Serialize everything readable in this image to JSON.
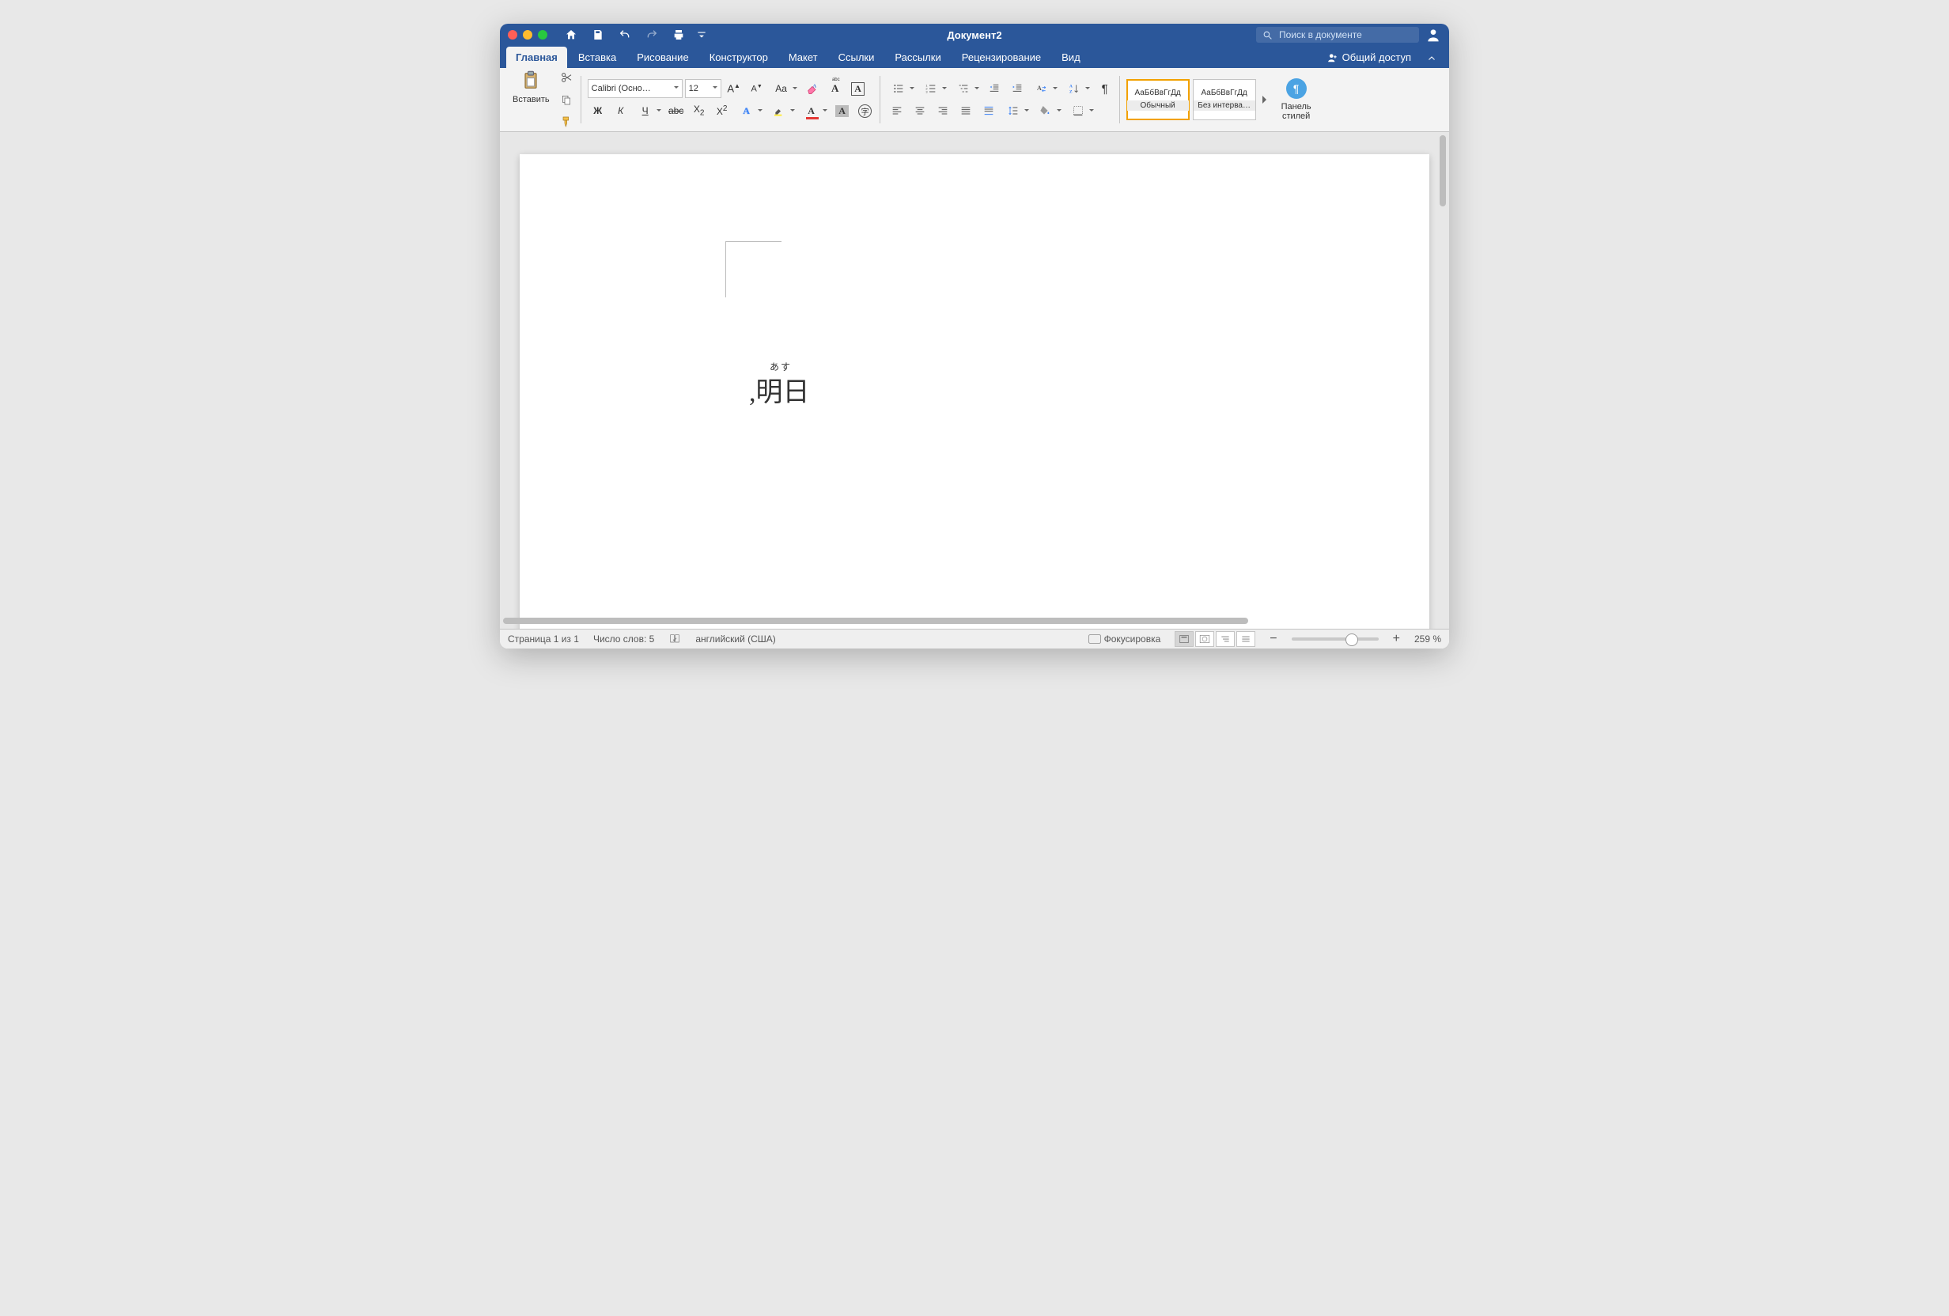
{
  "window_title": "Документ2",
  "search_placeholder": "Поиск в документе",
  "share_label": "Общий доступ",
  "tabs": [
    {
      "label": "Главная",
      "active": true
    },
    {
      "label": "Вставка"
    },
    {
      "label": "Рисование"
    },
    {
      "label": "Конструктор"
    },
    {
      "label": "Макет"
    },
    {
      "label": "Ссылки"
    },
    {
      "label": "Рассылки"
    },
    {
      "label": "Рецензирование"
    },
    {
      "label": "Вид"
    }
  ],
  "ribbon": {
    "paste_label": "Вставить",
    "font_name": "Calibri (Осно…",
    "font_size": "12",
    "bold": "Ж",
    "italic": "К",
    "underline": "Ч",
    "strike": "abc",
    "subscript": "X₂",
    "superscript": "X²",
    "styles_sample": "АаБбВвГгДд",
    "style_normal": "Обычный",
    "style_nointerval": "Без интерва…",
    "styles_pane": "Панель стилей"
  },
  "document": {
    "ruby": "あす",
    "content": ",明日"
  },
  "status": {
    "page": "Страница 1 из 1",
    "words": "Число слов: 5",
    "language": "английский (США)",
    "focus": "Фокусировка",
    "zoom": "259 %"
  }
}
